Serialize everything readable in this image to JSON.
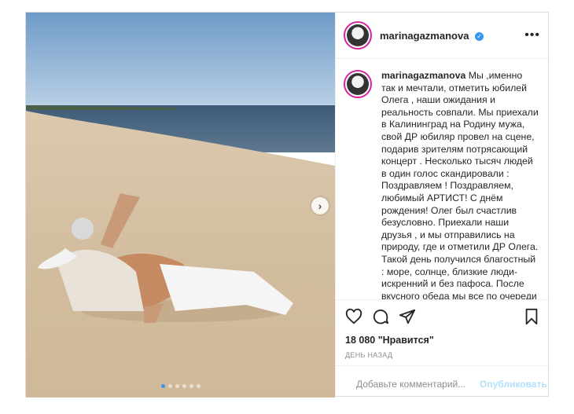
{
  "post": {
    "username": "marinagazmanova",
    "verified": true,
    "caption": "Мы ,именно так и мечтали, отметить юбилей Олега , наши ожидания и реальность совпали. Мы приехали в Калининград на Родину мужа, свой ДР юбиляр провел на сцене, подарив зрителям потрясающий концерт . Несколько тысяч людей в один голос скандировали : Поздравляем ! Поздравляем, любимый АРТИСТ! С днём рождения! Олег был счастлив безусловно. Приехали наши друзья , и мы отправились на природу, где и отметили ДР Олега. Такой день получился благостный : море, солнце, близкие люди-искренний и без пафоса. После вкусного обеда мы все по очереди подтянулись на зелёную дужайку с видом на залив.",
    "likes": "18 080 \"Нравится\"",
    "time": "ДЕНЬ НАЗАД",
    "carousel": {
      "count": 6,
      "active_index": 0
    }
  },
  "comment_box": {
    "placeholder": "Добавьте комментарий...",
    "publish_label": "Опубликовать"
  },
  "icons": {
    "more": "more-options-icon",
    "like": "heart-icon",
    "comment": "comment-icon",
    "share": "share-icon",
    "save": "bookmark-icon",
    "emoji": "emoji-icon",
    "next": "chevron-right-icon"
  },
  "colors": {
    "accent": "#3897f0",
    "story_ring": "#d6249f",
    "publish_disabled": "#b2dffc"
  }
}
